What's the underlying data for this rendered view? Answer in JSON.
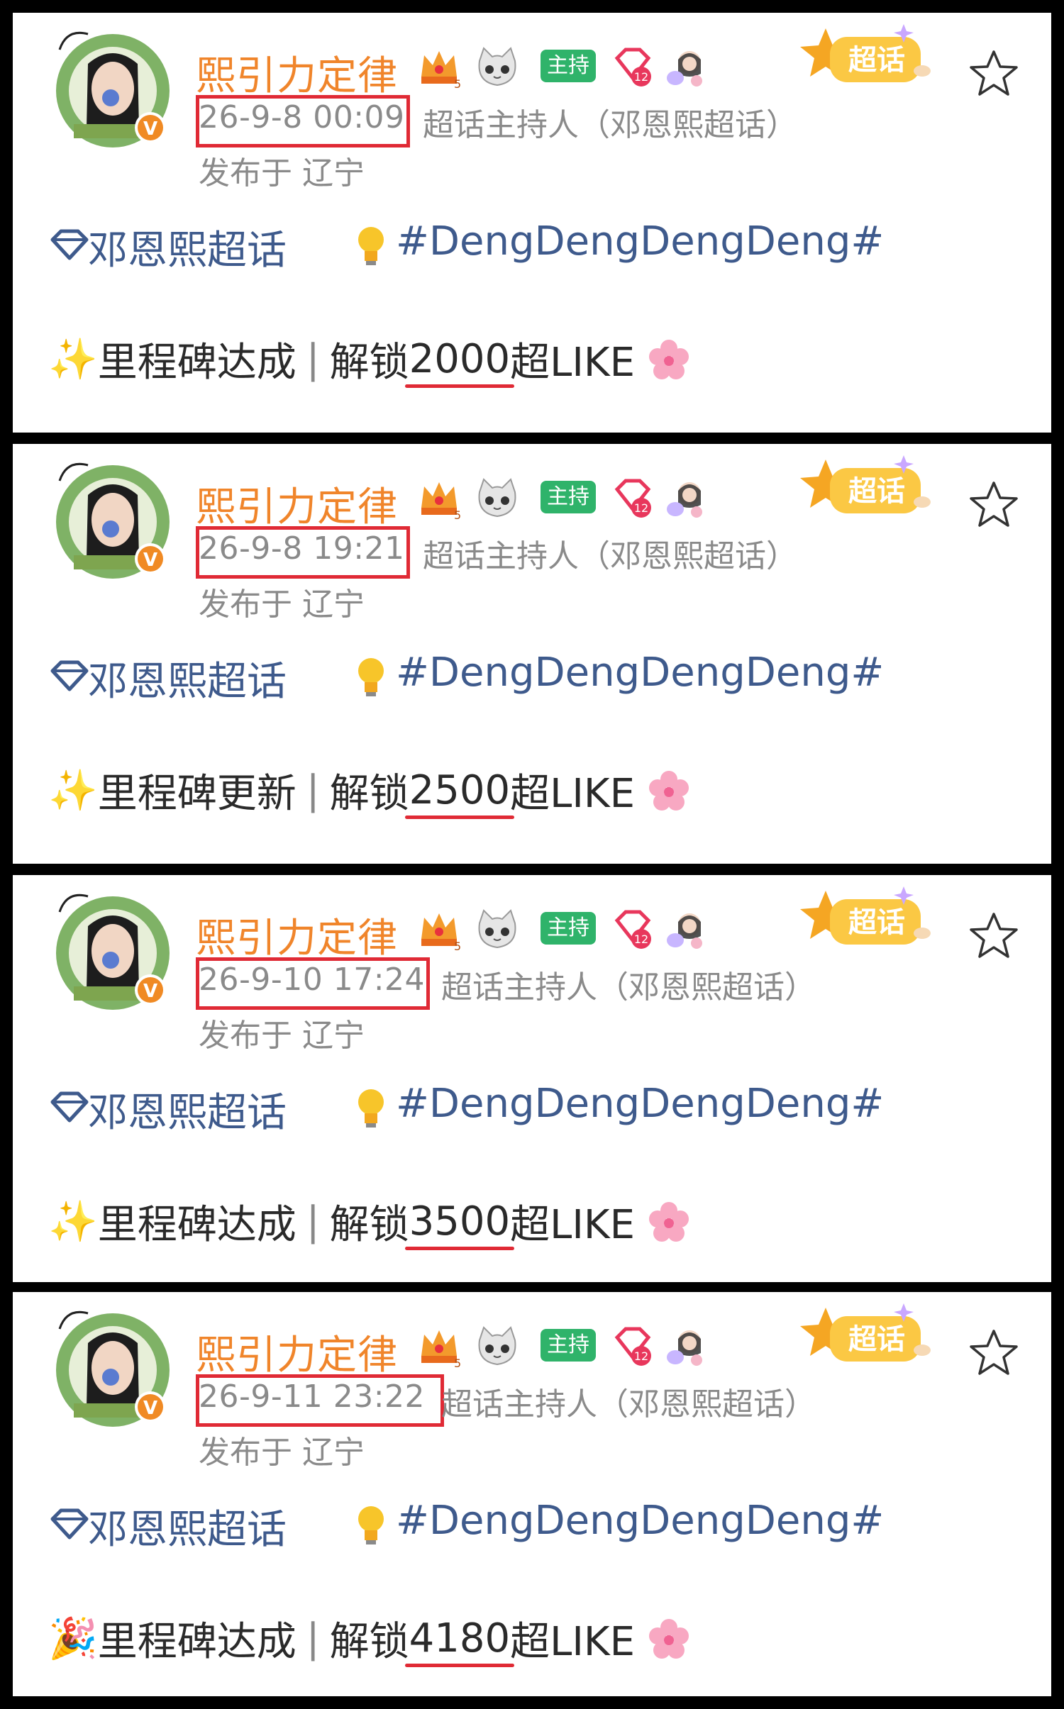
{
  "posts": [
    {
      "username": "熙引力定律",
      "host_badge": "主持",
      "time": "26-9-8 00:09",
      "role": "超话主持人（邓恩熙超话）",
      "location": "发布于 辽宁",
      "tag_label": "超话",
      "supertopic": "邓恩熙超话",
      "hashtag": "#DengDengDengDeng#",
      "milestone_prefix": "里程碑达成",
      "unlock_label": "解锁",
      "count": "2000",
      "unit": "超LIKE",
      "emoji": "✨"
    },
    {
      "username": "熙引力定律",
      "host_badge": "主持",
      "time": "26-9-8 19:21",
      "role": "超话主持人（邓恩熙超话）",
      "location": "发布于 辽宁",
      "tag_label": "超话",
      "supertopic": "邓恩熙超话",
      "hashtag": "#DengDengDengDeng#",
      "milestone_prefix": "里程碑更新",
      "unlock_label": "解锁",
      "count": "2500",
      "unit": "超LIKE",
      "emoji": "✨"
    },
    {
      "username": "熙引力定律",
      "host_badge": "主持",
      "time": "26-9-10 17:24",
      "role": "超话主持人（邓恩熙超话）",
      "location": "发布于 辽宁",
      "tag_label": "超话",
      "supertopic": "邓恩熙超话",
      "hashtag": "#DengDengDengDeng#",
      "milestone_prefix": "里程碑达成",
      "unlock_label": "解锁",
      "count": "3500",
      "unit": "超LIKE",
      "emoji": "✨"
    },
    {
      "username": "熙引力定律",
      "host_badge": "主持",
      "time": "26-9-11 23:22",
      "role": "超话主持人（邓恩熙超话）",
      "location": "发布于 辽宁",
      "tag_label": "超话",
      "supertopic": "邓恩熙超话",
      "hashtag": "#DengDengDengDeng#",
      "milestone_prefix": "里程碑达成",
      "unlock_label": "解锁",
      "count": "4180",
      "unit": "超LIKE",
      "emoji": "🎉"
    }
  ],
  "colors": {
    "username": "#f0852b",
    "meta": "#8a8a8a",
    "topic": "#3e5a8c",
    "highlight": "#e02a35",
    "host_badge": "#2fb36a"
  },
  "icons": [
    "verified-v-icon",
    "crown-level-icon",
    "cat-face-icon",
    "diamond-level-icon",
    "girl-sticker-icon",
    "supertopic-star-tag-icon",
    "star-outline-icon",
    "diamond-icon",
    "lightbulb-icon",
    "sparkles-icon",
    "party-popper-icon",
    "cherry-blossom-icon"
  ]
}
